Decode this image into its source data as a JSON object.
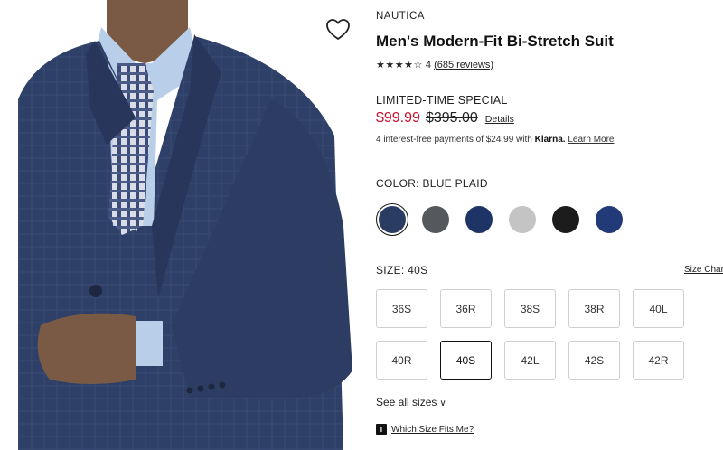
{
  "product": {
    "brand": "NAUTICA",
    "title": "Men's Modern-Fit Bi-Stretch Suit",
    "rating_stars": "★★★★☆",
    "rating_value": "4",
    "reviews": "(685 reviews)"
  },
  "pricing": {
    "promo": "LIMITED-TIME SPECIAL",
    "sale_price": "$99.99",
    "original_price": "$395.00",
    "details_label": "Details",
    "klarna_text": "4 interest-free payments of $24.99 with",
    "klarna_brand": "Klarna.",
    "learn_more": "Learn More",
    "sale_color": "#c8102e"
  },
  "colors": {
    "label": "COLOR: BLUE PLAID",
    "swatches": [
      {
        "name": "blue-plaid",
        "hex": "#2b3c63",
        "selected": true
      },
      {
        "name": "charcoal",
        "hex": "#55585d",
        "selected": false
      },
      {
        "name": "navy",
        "hex": "#1f3466",
        "selected": false
      },
      {
        "name": "light-grey",
        "hex": "#c4c4c4",
        "selected": false
      },
      {
        "name": "black",
        "hex": "#1c1c1c",
        "selected": false
      },
      {
        "name": "blue",
        "hex": "#233a78",
        "selected": false
      }
    ]
  },
  "sizes": {
    "label": "SIZE: 40S",
    "size_chart": "Size Chart",
    "options": [
      "36S",
      "36R",
      "38S",
      "38R",
      "40L",
      "40R",
      "40S",
      "42L",
      "42S",
      "42R"
    ],
    "selected": "40S",
    "see_all": "See all sizes",
    "fit_badge": "T",
    "fit_link": "Which Size Fits Me?"
  },
  "icons": {
    "wishlist": "heart-icon",
    "see_all_chevron": "chevron-down-icon"
  }
}
